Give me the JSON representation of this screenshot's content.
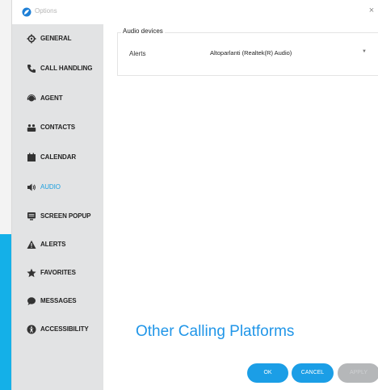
{
  "window": {
    "title": "Options",
    "close_glyph": "×"
  },
  "sidebar": {
    "items": [
      {
        "label": "GENERAL",
        "icon": "gear-icon"
      },
      {
        "label": "CALL HANDLING",
        "icon": "phone-icon"
      },
      {
        "label": "AGENT",
        "icon": "agent-icon"
      },
      {
        "label": "CONTACTS",
        "icon": "contacts-icon"
      },
      {
        "label": "CALENDAR",
        "icon": "calendar-icon"
      },
      {
        "label": "AUDIO",
        "icon": "speaker-icon",
        "active": true
      },
      {
        "label": "SCREEN POPUP",
        "icon": "monitor-icon"
      },
      {
        "label": "ALERTS",
        "icon": "warning-icon"
      },
      {
        "label": "FAVORITES",
        "icon": "star-icon"
      },
      {
        "label": "MESSAGES",
        "icon": "chat-bubble-icon"
      },
      {
        "label": "ACCESSIBILITY",
        "icon": "accessibility-icon"
      }
    ]
  },
  "audio": {
    "group_title": "Audio devices",
    "alerts_label": "Alerts",
    "alerts_value": "Altoparlanti (Realtek(R) Audio)"
  },
  "banner_text": "Other Calling Platforms",
  "buttons": {
    "ok": "OK",
    "cancel": "CANCEL",
    "apply": "APPLY"
  },
  "colors": {
    "accent": "#1b9ee6",
    "sidebar_bg": "#e2e3e4",
    "active_text": "#1a9fdf",
    "disabled": "#b5b7b9"
  }
}
